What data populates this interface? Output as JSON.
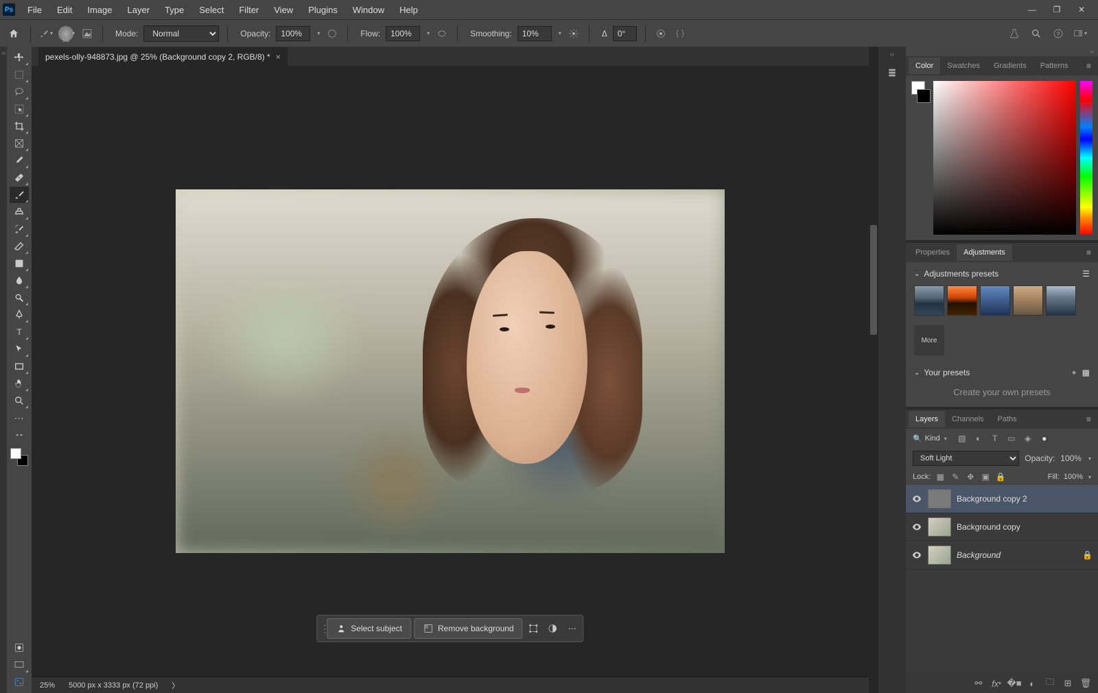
{
  "menu": [
    "File",
    "Edit",
    "Image",
    "Layer",
    "Type",
    "Select",
    "Filter",
    "View",
    "Plugins",
    "Window",
    "Help"
  ],
  "options": {
    "brush_size": "58",
    "mode_label": "Mode:",
    "mode_value": "Normal",
    "opacity_label": "Opacity:",
    "opacity_value": "100%",
    "flow_label": "Flow:",
    "flow_value": "100%",
    "smoothing_label": "Smoothing:",
    "smoothing_value": "10%",
    "angle_label": "Δ",
    "angle_value": "0°"
  },
  "doc_tab": "pexels-olly-948873.jpg @ 25% (Background copy 2, RGB/8) *",
  "context": {
    "select_subject": "Select subject",
    "remove_bg": "Remove background"
  },
  "status": {
    "zoom": "25%",
    "dims": "5000 px x 3333 px (72 ppi)",
    "caret": "〉"
  },
  "panels": {
    "color_tabs": [
      "Color",
      "Swatches",
      "Gradients",
      "Patterns"
    ],
    "prop_tabs": [
      "Properties",
      "Adjustments"
    ],
    "adj_presets_label": "Adjustments presets",
    "more": "More",
    "your_presets_label": "Your presets",
    "create_presets": "Create your own presets",
    "layer_tabs": [
      "Layers",
      "Channels",
      "Paths"
    ],
    "kind": "Kind",
    "blend_mode": "Soft Light",
    "opacity_label": "Opacity:",
    "opacity_value": "100%",
    "lock_label": "Lock:",
    "fill_label": "Fill:",
    "fill_value": "100%",
    "layers": [
      {
        "name": "Background copy 2",
        "active": true,
        "thumb": "gray"
      },
      {
        "name": "Background copy",
        "active": false,
        "thumb": "photo"
      },
      {
        "name": "Background",
        "active": false,
        "thumb": "photo",
        "italic": true,
        "locked": true
      }
    ]
  }
}
